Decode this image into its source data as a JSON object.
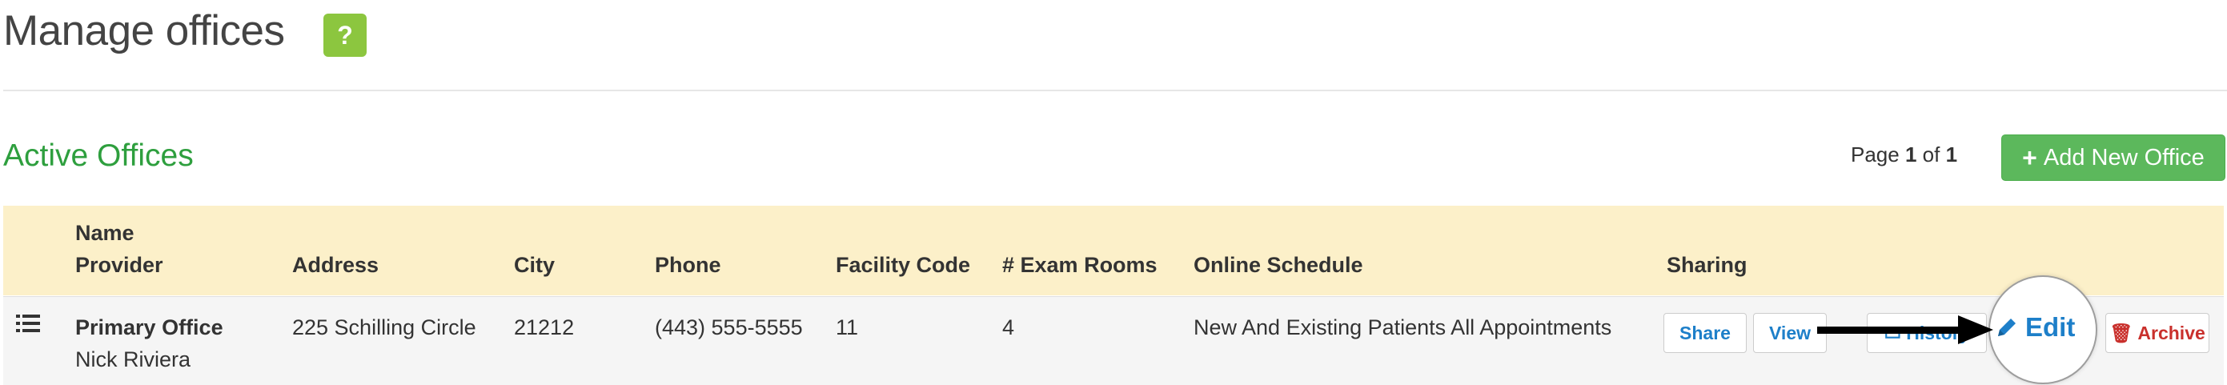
{
  "page": {
    "title": "Manage offices",
    "help_label": "?"
  },
  "section": {
    "title": "Active Offices"
  },
  "pager": {
    "prefix": "Page",
    "current": "1",
    "of": "of",
    "total": "1"
  },
  "toolbar": {
    "add_label": "Add New Office",
    "add_icon": "plus-icon"
  },
  "table": {
    "headers": {
      "name": "Name",
      "provider": "Provider",
      "address": "Address",
      "city": "City",
      "phone": "Phone",
      "facility_code": "Facility Code",
      "exam_rooms": "# Exam Rooms",
      "online_schedule": "Online Schedule",
      "sharing": "Sharing"
    },
    "rows": [
      {
        "name": "Primary Office",
        "provider": "Nick Riviera",
        "address": "225 Schilling Circle",
        "city": "21212",
        "phone": "(443) 555-5555",
        "facility_code": "11",
        "exam_rooms": "4",
        "online_schedule": "New And Existing Patients All Appointments",
        "actions": {
          "share": "Share",
          "view": "View",
          "history": "History",
          "edit": "Edit",
          "archive": "Archive"
        }
      }
    ]
  },
  "colors": {
    "accent_green": "#2e9f3e",
    "button_green": "#5cb85c",
    "help_green": "#8cc63f",
    "header_bg": "#fcf0c9",
    "link_blue": "#1d7fc9",
    "danger_red": "#c9302c"
  }
}
